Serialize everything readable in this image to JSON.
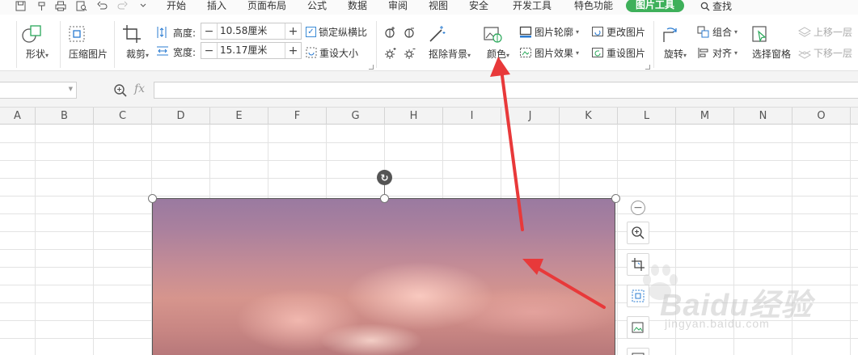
{
  "quick_access": [
    "save-icon",
    "format-painter-icon",
    "print-icon",
    "print-preview-icon",
    "undo-icon",
    "redo-icon",
    "more-icon"
  ],
  "menu": {
    "tabs": [
      "开始",
      "插入",
      "页面布局",
      "公式",
      "数据",
      "审阅",
      "视图",
      "安全",
      "开发工具",
      "特色功能"
    ],
    "active_tab": "图片工具",
    "search": "查找",
    "active_color": "#3eb05a"
  },
  "ribbon": {
    "shape": "形状",
    "compress": "压缩图片",
    "crop": "裁剪",
    "height_label": "高度:",
    "height_value": "10.58厘米",
    "width_label": "宽度:",
    "width_value": "15.17厘米",
    "lock_ratio": "锁定纵横比",
    "reset_size": "重设大小",
    "remove_bg": "抠除背景",
    "color": "颜色",
    "picture_outline": "图片轮廓",
    "picture_effect": "图片效果",
    "change_picture": "更改图片",
    "reset_picture": "重设图片",
    "rotate": "旋转",
    "group": "组合",
    "align": "对齐",
    "selection_pane": "选择窗格",
    "bring_forward": "上移一层",
    "send_backward": "下移一层"
  },
  "formula_bar": {
    "fx": "fx"
  },
  "columns": [
    "A",
    "B",
    "C",
    "D",
    "E",
    "F",
    "G",
    "H",
    "I",
    "J",
    "K",
    "L",
    "M",
    "N",
    "O"
  ],
  "side_toolbar": [
    "zoom-in-icon",
    "crop-icon",
    "compress-icon",
    "change-picture-icon",
    "more-icon"
  ],
  "watermark": {
    "brand": "Baidu经验",
    "url": "jingyan.baidu.com"
  },
  "annotation_color": "#e8393a"
}
